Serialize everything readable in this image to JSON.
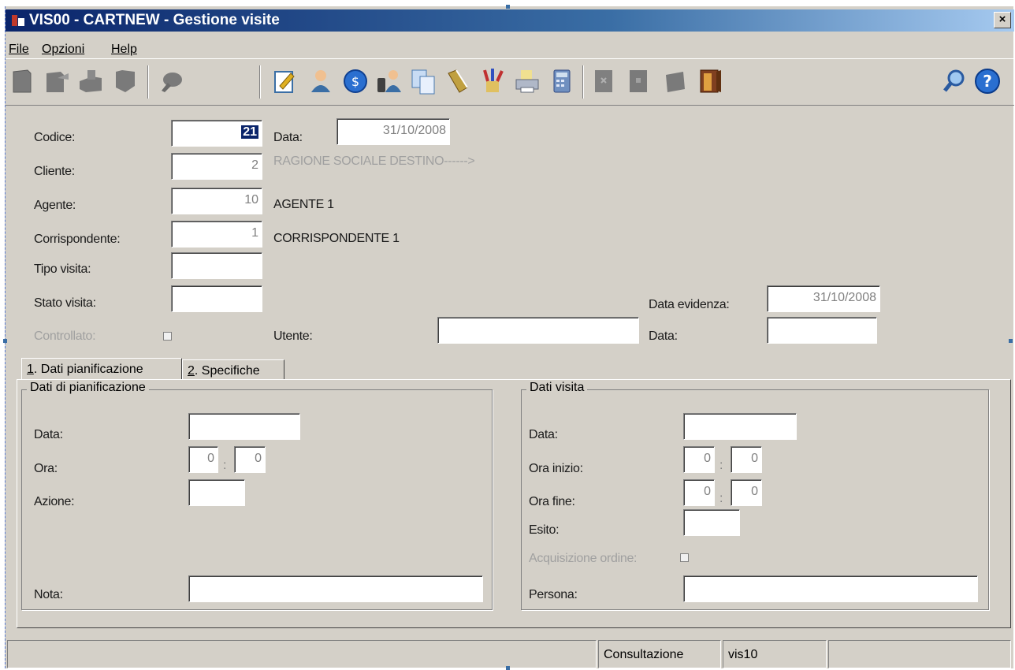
{
  "window": {
    "title": "VIS00 - CARTNEW - Gestione visite",
    "close_glyph": "×"
  },
  "menu": [
    {
      "label": "File"
    },
    {
      "label": "Opzioni"
    },
    {
      "label": "Help"
    }
  ],
  "toolbar": {
    "icons": [
      "new-record-icon",
      "edit-record-icon",
      "save-record-icon",
      "delete-record-icon",
      "search-icon",
      "notepad-icon",
      "contacts-icon",
      "money-icon",
      "agents-icon",
      "copy-icon",
      "book-icon",
      "pens-icon",
      "print-icon",
      "calculator-icon",
      "grid-icon",
      "block-icon",
      "exit-icon",
      "find-icon",
      "help-icon"
    ]
  },
  "form": {
    "codice": {
      "label": "Codice:",
      "value": "21"
    },
    "data": {
      "label": "Data:",
      "value": "31/10/2008"
    },
    "cliente": {
      "label": "Cliente:",
      "value": "2",
      "description": "RAGIONE SOCIALE DESTINO------>"
    },
    "agente": {
      "label": "Agente:",
      "value": "10",
      "description": "AGENTE 1"
    },
    "corrispondente": {
      "label": "Corrispondente:",
      "value": "1",
      "description": "CORRISPONDENTE 1"
    },
    "tipo_visita": {
      "label": "Tipo visita:",
      "value": ""
    },
    "stato_visita": {
      "label": "Stato visita:",
      "value": ""
    },
    "data_evidenza": {
      "label": "Data evidenza:",
      "value": "31/10/2008"
    },
    "controllato": {
      "label": "Controllato:"
    },
    "utente": {
      "label": "Utente:",
      "value": ""
    },
    "data2": {
      "label": "Data:",
      "value": ""
    }
  },
  "tabs": [
    {
      "key": "1",
      "label": ". Dati pianificazione"
    },
    {
      "key": "2",
      "label": ". Specifiche"
    }
  ],
  "pianificazione": {
    "title": "Dati di pianificazione",
    "data_label": "Data:",
    "ora_label": "Ora:",
    "ora_h": "0",
    "ora_m": "0",
    "azione_label": "Azione:",
    "nota_label": "Nota:"
  },
  "visita": {
    "title": "Dati visita",
    "data_label": "Data:",
    "ora_inizio_label": "Ora inizio:",
    "ora_inizio_h": "0",
    "ora_inizio_m": "0",
    "ora_fine_label": "Ora fine:",
    "ora_fine_h": "0",
    "ora_fine_m": "0",
    "esito_label": "Esito:",
    "acquisizione_label": "Acquisizione ordine:",
    "persona_label": "Persona:"
  },
  "status": {
    "mode": "Consultazione",
    "form_code": "vis10"
  }
}
